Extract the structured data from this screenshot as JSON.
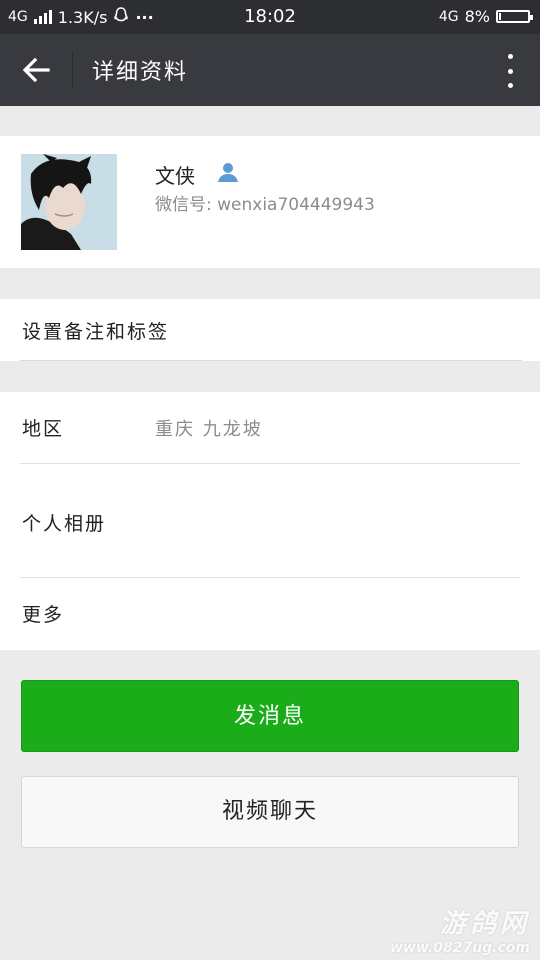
{
  "status_bar": {
    "network_left": "4G",
    "speed": "1.3K/s",
    "qq_icon": "qq-penguin-icon",
    "dots": "···",
    "time": "18:02",
    "network_right": "4G",
    "battery_text": "8%",
    "battery_level": 0.08
  },
  "header": {
    "title": "详细资料",
    "back_icon": "arrow-left-icon",
    "more_icon": "more-vertical-icon"
  },
  "profile": {
    "name": "文侠",
    "gender_icon": "person-icon",
    "wechat_id": "微信号: wenxia704449943"
  },
  "remark": {
    "label": "设置备注和标签"
  },
  "details": {
    "region_label": "地区",
    "region_value": "重庆  九龙坡",
    "album_label": "个人相册",
    "more_label": "更多"
  },
  "actions": {
    "send_message": "发消息",
    "video_chat": "视频聊天"
  },
  "watermark": {
    "text": "游鸽网",
    "url": "www.0827ug.com"
  },
  "colors": {
    "accent_green": "#1aad19",
    "header_bg": "#393a3f",
    "status_bg": "#2d2e31"
  }
}
